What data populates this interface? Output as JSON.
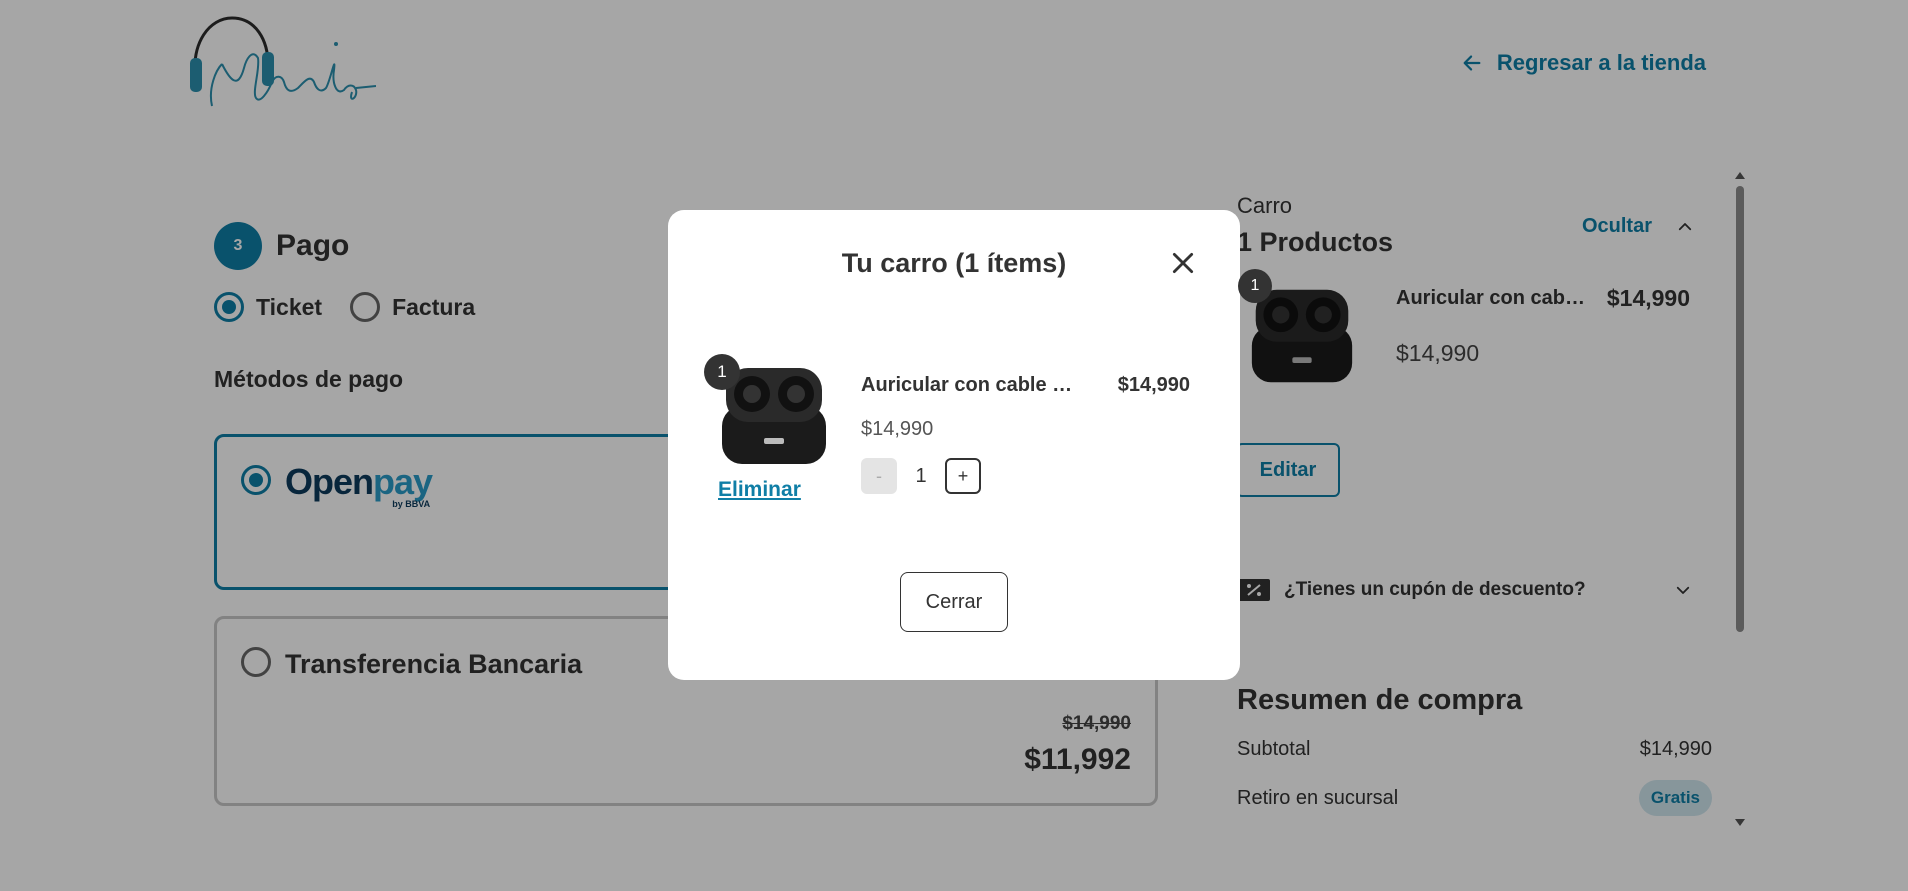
{
  "header": {
    "back_label": "Regresar a la tienda"
  },
  "payment": {
    "step_number": "3",
    "step_title": "Pago",
    "doc_options": [
      {
        "label": "Ticket",
        "selected": true
      },
      {
        "label": "Factura",
        "selected": false
      }
    ],
    "methods_title": "Métodos de pago",
    "openpay": {
      "brand_a": "O",
      "brand_b": "pen",
      "brand_c": "pay",
      "brand_sub": "by BBVA"
    },
    "transfer": {
      "label": "Transferencia Bancaria",
      "old_price": "$14,990",
      "new_price": "$11,992"
    }
  },
  "sidebar": {
    "cart_label": "Carro",
    "cart_count": "1 Productos",
    "hide_label": "Ocultar",
    "item": {
      "qty_badge": "1",
      "name": "Auricular con cable y ...",
      "price": "$14,990",
      "unit_price": "$14,990"
    },
    "edit_label": "Editar",
    "coupon_label": "¿Tienes un cupón de descuento?",
    "summary": {
      "title": "Resumen de compra",
      "subtotal_label": "Subtotal",
      "subtotal_value": "$14,990",
      "pickup_label": "Retiro en sucursal",
      "pickup_value": "Gratis"
    }
  },
  "modal": {
    "title": "Tu carro (1 ítems)",
    "item": {
      "qty_badge": "1",
      "name": "Auricular con cable y ...",
      "price": "$14,990",
      "unit_price": "$14,990",
      "remove_label": "Eliminar",
      "quantity": "1",
      "minus_label": "-",
      "plus_label": "+"
    },
    "close_label": "Cerrar"
  },
  "colors": {
    "accent": "#0f7ea6",
    "overlay": "rgba(0,0,0,0.35)"
  }
}
